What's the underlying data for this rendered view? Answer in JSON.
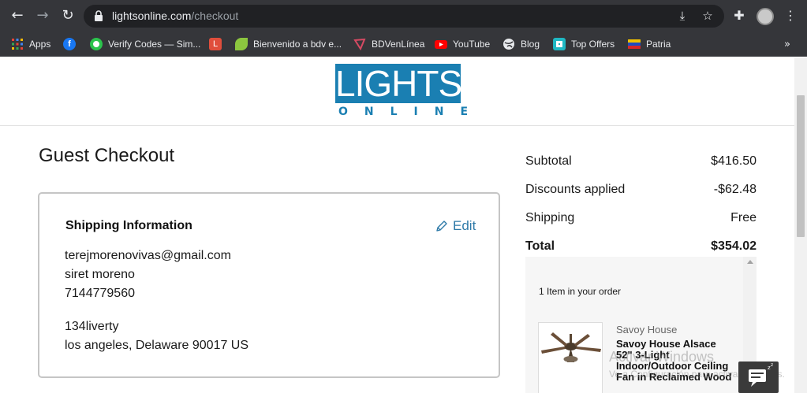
{
  "browser": {
    "url_host": "lightsonline.com",
    "url_path": "/checkout",
    "nav": {
      "back_icon": "arrow-left-icon",
      "forward_icon": "arrow-right-icon",
      "reload_icon": "reload-icon"
    },
    "bookmarks": [
      {
        "label": "Apps",
        "icon": "apps-grid-icon",
        "color": "#e8eaed"
      },
      {
        "label": "",
        "icon": "facebook-icon",
        "color": "#1877f2"
      },
      {
        "label": "Verify Codes — Sim...",
        "icon": "verify-codes-icon",
        "color": "#2bc44c"
      },
      {
        "label": "",
        "icon": "l-letter-icon",
        "color": "#e04e3c"
      },
      {
        "label": "Bienvenido a bdv e...",
        "icon": "leaf-icon",
        "color": "#8cc63f"
      },
      {
        "label": "BDVenLínea",
        "icon": "bdv-icon",
        "color": "#d64a63"
      },
      {
        "label": "YouTube",
        "icon": "youtube-icon",
        "color": "#ff0000"
      },
      {
        "label": "Blog",
        "icon": "globe-icon",
        "color": "#e8eaed"
      },
      {
        "label": "Top Offers",
        "icon": "top-offers-icon",
        "color": "#1fb8c3"
      },
      {
        "label": "Patria",
        "icon": "patria-icon",
        "color": "#f2c200"
      }
    ]
  },
  "site": {
    "logo_word": "LIGHTS",
    "logo_sub": "ONLINE",
    "brand_color": "#1a7fb2"
  },
  "checkout": {
    "title": "Guest Checkout",
    "shipping": {
      "heading": "Shipping Information",
      "edit_label": "Edit",
      "email": "terejmorenovivas@gmail.com",
      "name": "siret moreno",
      "phone": "7144779560",
      "street": "134liverty",
      "city_line": "los angeles, Delaware 90017 US"
    }
  },
  "summary": {
    "rows": [
      {
        "label": "Subtotal",
        "value": "$416.50"
      },
      {
        "label": "Discounts applied",
        "value": "-$62.48"
      },
      {
        "label": "Shipping",
        "value": "Free"
      }
    ],
    "total": {
      "label": "Total",
      "value": "$354.02"
    },
    "order_count": "1 Item in your order",
    "item": {
      "brand": "Savoy House",
      "name": "Savoy House Alsace 52\" 3-Light Indoor/Outdoor Ceiling Fan in Reclaimed Wood"
    }
  },
  "overlay": {
    "watermark_title": "Activar Windows",
    "watermark_sub": "Ve a Configuración para activar Windows."
  }
}
